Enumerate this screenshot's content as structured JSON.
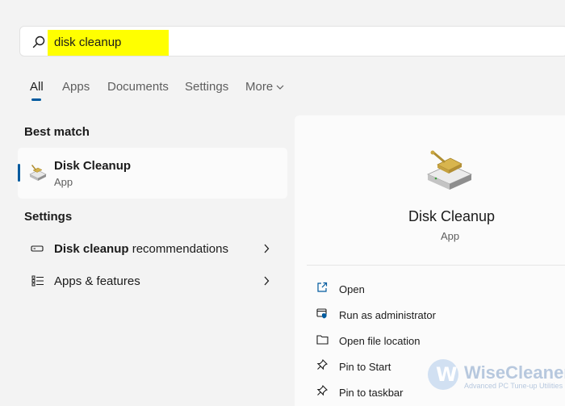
{
  "search": {
    "query": "disk cleanup"
  },
  "tabs": [
    {
      "label": "All",
      "active": true
    },
    {
      "label": "Apps"
    },
    {
      "label": "Documents"
    },
    {
      "label": "Settings"
    },
    {
      "label": "More"
    }
  ],
  "best_match": {
    "heading": "Best match",
    "title": "Disk Cleanup",
    "subtitle": "App"
  },
  "settings": {
    "heading": "Settings",
    "items": [
      {
        "bold": "Disk cleanup",
        "rest": " recommendations"
      },
      {
        "bold": "",
        "rest": "Apps & features"
      }
    ]
  },
  "detail": {
    "title": "Disk Cleanup",
    "subtitle": "App",
    "actions": [
      {
        "label": "Open",
        "icon": "open-icon"
      },
      {
        "label": "Run as administrator",
        "icon": "shield-icon"
      },
      {
        "label": "Open file location",
        "icon": "folder-icon"
      },
      {
        "label": "Pin to Start",
        "icon": "pin-icon"
      },
      {
        "label": "Pin to taskbar",
        "icon": "pin-icon"
      }
    ]
  },
  "watermark": {
    "letter": "W",
    "brand": "WiseCleaner",
    "tagline": "Advanced PC Tune-up Utilities"
  },
  "colors": {
    "accent": "#005a9e",
    "highlight": "#ffff00",
    "background": "#f3f3f3"
  }
}
